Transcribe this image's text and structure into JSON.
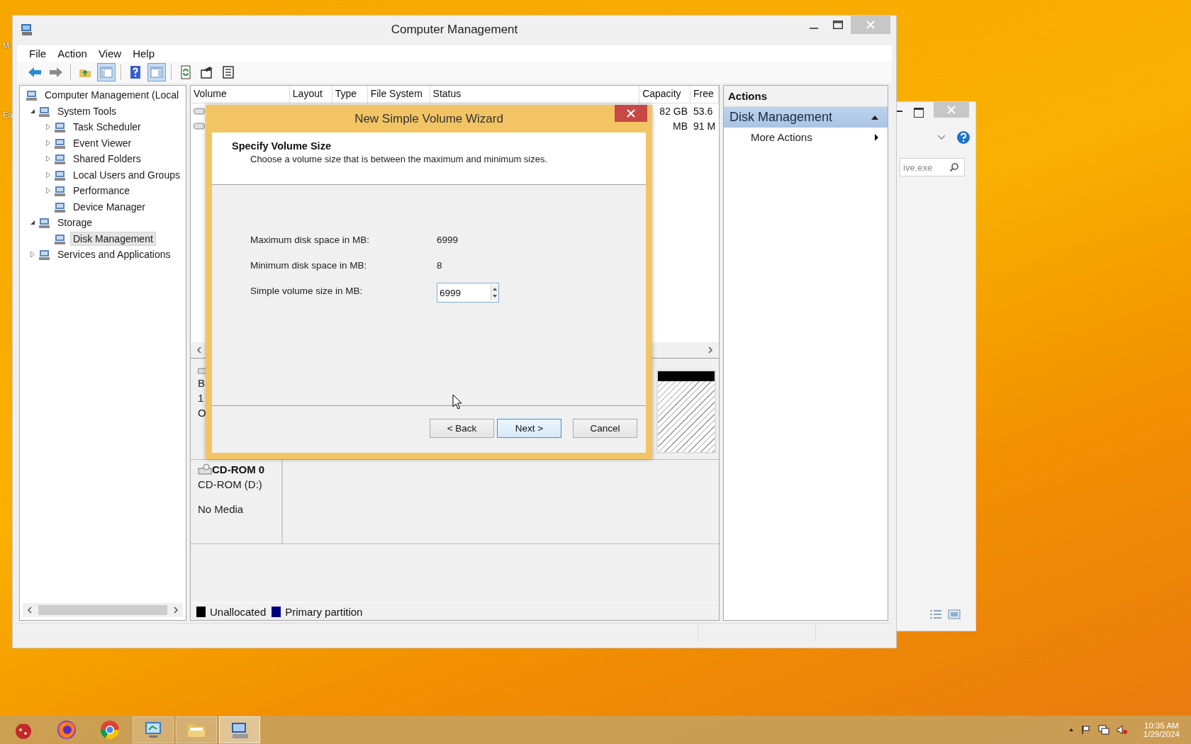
{
  "desktop": {
    "labels": [
      "M",
      "Ea"
    ]
  },
  "back_window": {
    "search": {
      "placeholder": "ive.exe"
    }
  },
  "window": {
    "title": "Computer Management"
  },
  "menu": [
    "File",
    "Action",
    "View",
    "Help"
  ],
  "toolbar": [
    {
      "kind": "back",
      "pressed": false
    },
    {
      "kind": "forward",
      "pressed": false
    },
    {
      "kind": "sep"
    },
    {
      "kind": "up",
      "pressed": false
    },
    {
      "kind": "tree",
      "pressed": true
    },
    {
      "kind": "sep"
    },
    {
      "kind": "help",
      "pressed": false
    },
    {
      "kind": "pane",
      "pressed": true
    },
    {
      "kind": "sep"
    },
    {
      "kind": "refresh",
      "pressed": false
    },
    {
      "kind": "properties",
      "pressed": false
    },
    {
      "kind": "export",
      "pressed": false
    }
  ],
  "tree": {
    "items": [
      {
        "label": "Computer Management (Local",
        "selected": false,
        "children": [
          {
            "label": "System Tools",
            "expanded": true,
            "selected": false,
            "children": [
              {
                "label": "Task Scheduler",
                "expanded": false,
                "selected": false
              },
              {
                "label": "Event Viewer",
                "expanded": false,
                "selected": false
              },
              {
                "label": "Shared Folders",
                "expanded": false,
                "selected": false
              },
              {
                "label": "Local Users and Groups",
                "expanded": false,
                "selected": false
              },
              {
                "label": "Performance",
                "expanded": false,
                "selected": false
              },
              {
                "label": "Device Manager",
                "selected": false
              }
            ]
          },
          {
            "label": "Storage",
            "expanded": true,
            "selected": false,
            "children": [
              {
                "label": "Disk Management",
                "selected": true
              }
            ]
          },
          {
            "label": "Services and Applications",
            "expanded": false,
            "selected": false
          }
        ]
      }
    ]
  },
  "table": {
    "columns": [
      "Volume",
      "Layout",
      "Type",
      "File System",
      "Status",
      "Capacity",
      "Free"
    ],
    "rows": [
      {
        "capacity": "82 GB",
        "free": "53.6"
      },
      {
        "capacity": "MB",
        "free": "91 M"
      }
    ]
  },
  "disk_0": {
    "labels": [
      "B",
      "1",
      "O"
    ],
    "partition": {
      "kind": "unallocated",
      "selected": true
    }
  },
  "cdrom": {
    "name": "CD-ROM 0",
    "drive": "CD-ROM (D:)",
    "status": "No Media"
  },
  "legend": [
    {
      "label": "Unallocated",
      "color": "#000000"
    },
    {
      "label": "Primary partition",
      "color": "#000080"
    }
  ],
  "actions": {
    "header": "Actions",
    "section": {
      "label": "Disk Management",
      "expanded": true
    },
    "items": [
      "More Actions"
    ]
  },
  "wizard": {
    "title": "New Simple Volume Wizard",
    "heading": "Specify Volume Size",
    "description": "Choose a volume size that is between the maximum and minimum sizes.",
    "fields": [
      {
        "kind": "text",
        "label": "Maximum disk space in MB:",
        "value": "6999"
      },
      {
        "kind": "text",
        "label": "Minimum disk space in MB:",
        "value": "8"
      },
      {
        "kind": "spinner",
        "label": "Simple volume size in MB:",
        "value": "6999"
      }
    ],
    "buttons": [
      {
        "label": "< Back",
        "default": false
      },
      {
        "label": "Next >",
        "default": true
      },
      {
        "label": "Cancel",
        "default": false
      }
    ]
  },
  "taskbar": {
    "apps": [
      {
        "kind": "ornament",
        "running": false,
        "selected": false
      },
      {
        "kind": "fox",
        "running": false,
        "selected": false
      },
      {
        "kind": "wheel",
        "running": false,
        "selected": false
      },
      {
        "kind": "monitor",
        "running": true,
        "selected": false
      },
      {
        "kind": "folder",
        "running": true,
        "selected": false
      },
      {
        "kind": "computer",
        "running": true,
        "selected": true
      }
    ],
    "time": "10:35 AM",
    "date": "1/29/2024"
  }
}
